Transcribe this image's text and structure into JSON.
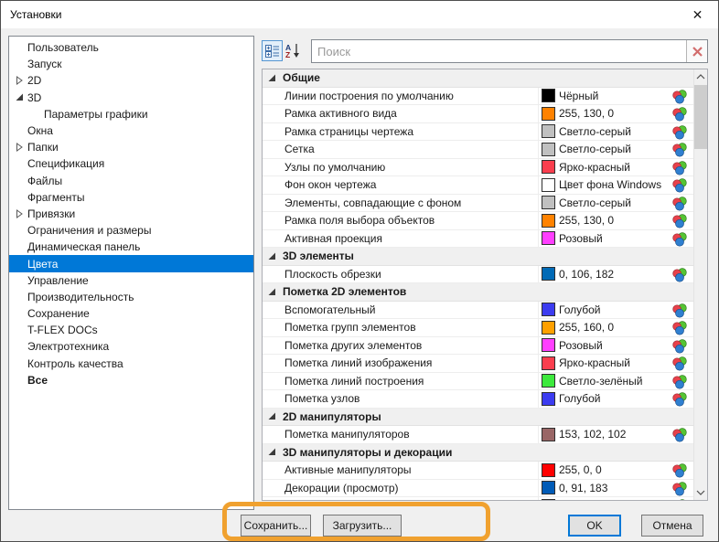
{
  "window": {
    "title": "Установки",
    "close_icon": "✕"
  },
  "toolbar": {
    "search_placeholder": "Поиск",
    "search_value": ""
  },
  "sidebar": {
    "selection_color": "#0078d7",
    "items": [
      {
        "label": "Пользователь",
        "level": 1,
        "arrow": null,
        "selected": false,
        "bold": false
      },
      {
        "label": "Запуск",
        "level": 1,
        "arrow": null,
        "selected": false,
        "bold": false
      },
      {
        "label": "2D",
        "level": 1,
        "arrow": "collapsed",
        "selected": false,
        "bold": false
      },
      {
        "label": "3D",
        "level": 1,
        "arrow": "expanded",
        "selected": false,
        "bold": false
      },
      {
        "label": "Параметры графики",
        "level": 2,
        "arrow": null,
        "selected": false,
        "bold": false
      },
      {
        "label": "Окна",
        "level": 1,
        "arrow": null,
        "selected": false,
        "bold": false
      },
      {
        "label": "Папки",
        "level": 1,
        "arrow": "collapsed",
        "selected": false,
        "bold": false
      },
      {
        "label": "Спецификация",
        "level": 1,
        "arrow": null,
        "selected": false,
        "bold": false
      },
      {
        "label": "Файлы",
        "level": 1,
        "arrow": null,
        "selected": false,
        "bold": false
      },
      {
        "label": "Фрагменты",
        "level": 1,
        "arrow": null,
        "selected": false,
        "bold": false
      },
      {
        "label": "Привязки",
        "level": 1,
        "arrow": "collapsed",
        "selected": false,
        "bold": false
      },
      {
        "label": "Ограничения и размеры",
        "level": 1,
        "arrow": null,
        "selected": false,
        "bold": false
      },
      {
        "label": "Динамическая панель",
        "level": 1,
        "arrow": null,
        "selected": false,
        "bold": false
      },
      {
        "label": "Цвета",
        "level": 1,
        "arrow": null,
        "selected": true,
        "bold": false
      },
      {
        "label": "Управление",
        "level": 1,
        "arrow": null,
        "selected": false,
        "bold": false
      },
      {
        "label": "Производительность",
        "level": 1,
        "arrow": null,
        "selected": false,
        "bold": false
      },
      {
        "label": "Сохранение",
        "level": 1,
        "arrow": null,
        "selected": false,
        "bold": false
      },
      {
        "label": "T-FLEX DOCs",
        "level": 1,
        "arrow": null,
        "selected": false,
        "bold": false
      },
      {
        "label": "Электротехника",
        "level": 1,
        "arrow": null,
        "selected": false,
        "bold": false
      },
      {
        "label": "Контроль качества",
        "level": 1,
        "arrow": null,
        "selected": false,
        "bold": false
      },
      {
        "label": "Все",
        "level": 1,
        "arrow": null,
        "selected": false,
        "bold": true
      }
    ]
  },
  "list": {
    "groups": [
      {
        "title": "Общие",
        "items": [
          {
            "label": "Линии построения по умолчанию",
            "swatch": "#000000",
            "value": "Чёрный"
          },
          {
            "label": "Рамка активного вида",
            "swatch": "#ff8200",
            "value": "255, 130, 0"
          },
          {
            "label": "Рамка страницы чертежа",
            "swatch": "#c0c0c0",
            "value": "Светло-серый"
          },
          {
            "label": "Сетка",
            "swatch": "#c0c0c0",
            "value": "Светло-серый"
          },
          {
            "label": "Узлы по умолчанию",
            "swatch": "#fa3e4e",
            "value": "Ярко-красный"
          },
          {
            "label": "Фон окон чертежа",
            "swatch": "#ffffff",
            "value": "Цвет фона Windows"
          },
          {
            "label": "Элементы, совпадающие с фоном",
            "swatch": "#c0c0c0",
            "value": "Светло-серый"
          },
          {
            "label": "Рамка поля выбора объектов",
            "swatch": "#ff8200",
            "value": "255, 130, 0"
          },
          {
            "label": "Активная проекция",
            "swatch": "#ff3fff",
            "value": "Розовый"
          }
        ]
      },
      {
        "title": "3D элементы",
        "items": [
          {
            "label": "Плоскость обрезки",
            "swatch": "#006ab6",
            "value": "0, 106, 182"
          }
        ]
      },
      {
        "title": "Пометка 2D элементов",
        "items": [
          {
            "label": "Вспомогательный",
            "swatch": "#3c3cf0",
            "value": "Голубой"
          },
          {
            "label": "Пометка групп элементов",
            "swatch": "#ffa000",
            "value": "255, 160, 0"
          },
          {
            "label": "Пометка других элементов",
            "swatch": "#ff3fff",
            "value": "Розовый"
          },
          {
            "label": "Пометка линий изображения",
            "swatch": "#fa3e4e",
            "value": "Ярко-красный"
          },
          {
            "label": "Пометка линий построения",
            "swatch": "#3de93d",
            "value": "Светло-зелёный"
          },
          {
            "label": "Пометка узлов",
            "swatch": "#3c3cf0",
            "value": "Голубой"
          }
        ]
      },
      {
        "title": "2D манипуляторы",
        "items": [
          {
            "label": "Пометка манипуляторов",
            "swatch": "#996666",
            "value": "153, 102, 102"
          }
        ]
      },
      {
        "title": "3D манипуляторы и декорации",
        "items": [
          {
            "label": "Активные манипуляторы",
            "swatch": "#ff0000",
            "value": "255, 0, 0"
          },
          {
            "label": "Декорации (просмотр)",
            "swatch": "#005bb7",
            "value": "0, 91, 183"
          },
          {
            "label": "",
            "swatch": "#2ee1e1",
            "value": "",
            "partial": true
          }
        ]
      }
    ]
  },
  "footer": {
    "save": "Сохранить...",
    "load": "Загрузить...",
    "ok": "OK",
    "cancel": "Отмена"
  },
  "colors": {
    "selection": "#0078d7",
    "annotation_highlight": "#f0a12f"
  }
}
